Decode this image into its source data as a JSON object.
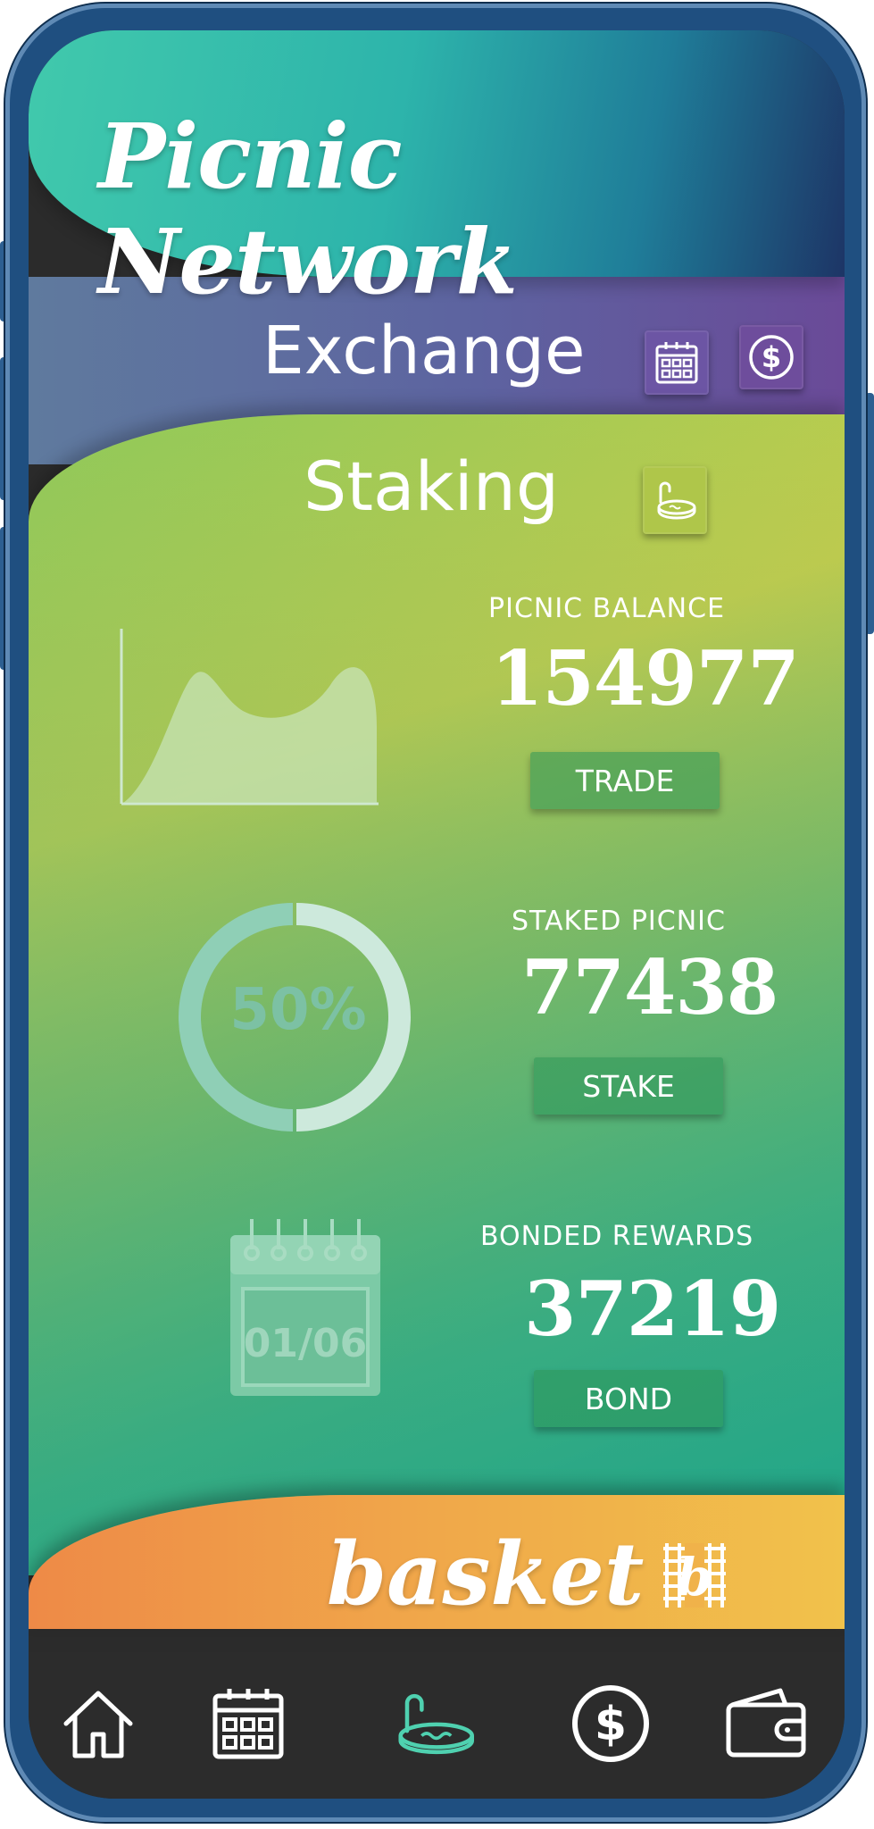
{
  "app": {
    "title": "Picnic Network"
  },
  "exchange": {
    "label": "Exchange",
    "calendar_icon": "calendar-icon",
    "dollar_icon": "dollar-icon"
  },
  "staking": {
    "label": "Staking",
    "tub_icon": "hot-tub-icon",
    "donut_value": "50%",
    "calendar_date": "01/06",
    "stats": [
      {
        "label": "PICNIC BALANCE",
        "value": "154977",
        "button": "TRADE"
      },
      {
        "label": "STAKED PICNIC",
        "value": "77438",
        "button": "STAKE"
      },
      {
        "label": "BONDED REWARDS",
        "value": "37219",
        "button": "BOND"
      }
    ],
    "donut_percent": 50
  },
  "basket": {
    "label": "basket",
    "icon": "basket-b-icon"
  },
  "nav": {
    "items": [
      "home-icon",
      "calendar-icon",
      "hot-tub-icon",
      "dollar-icon",
      "wallet-icon"
    ],
    "active_index": 2
  },
  "colors": {
    "accent_teal": "#4fd1b0",
    "nav_bg": "#2c2c2c",
    "basket_orange": "#ee8a47",
    "exchange_purple": "#6a4a98"
  }
}
